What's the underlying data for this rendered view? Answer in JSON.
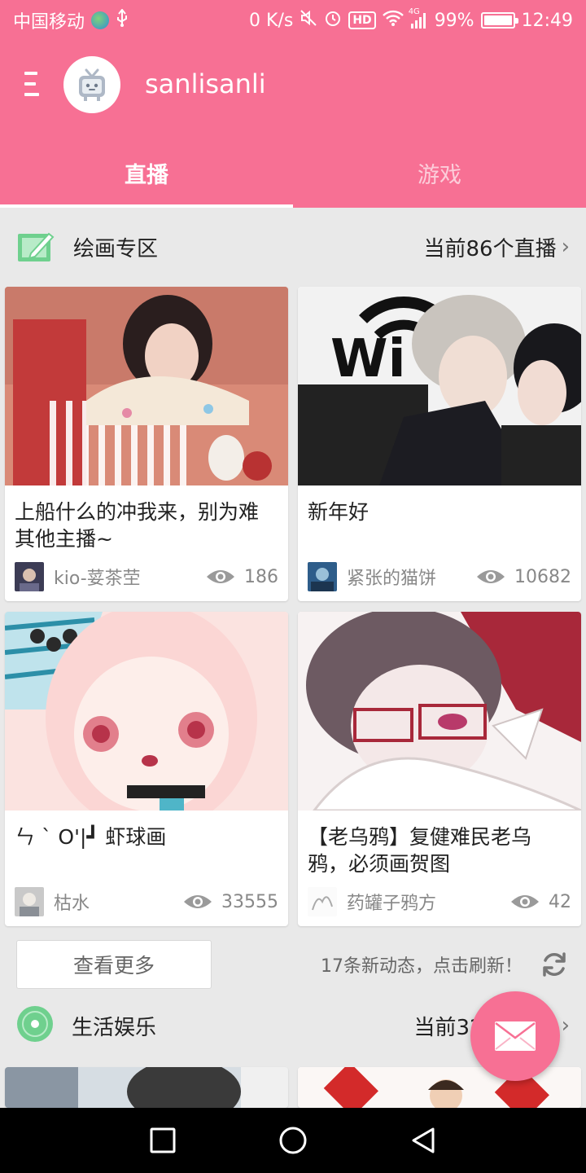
{
  "status_bar": {
    "carrier": "中国移动",
    "net_speed": "0 K/s",
    "signal_label": "4G",
    "hd_label": "HD",
    "battery": "99%",
    "battery_level": 0.99,
    "time": "12:49"
  },
  "header": {
    "username": "sanlisanli",
    "tabs": [
      {
        "label": "直播",
        "active": true
      },
      {
        "label": "游戏",
        "active": false
      }
    ]
  },
  "sections": [
    {
      "title": "绘画专区",
      "right_text": "当前86个直播",
      "icon": "drawing-board-icon",
      "cards": [
        {
          "title": "上船什么的冲我来，别为难其他主播~",
          "owner": "kio-荽茶茔",
          "views": "186"
        },
        {
          "title": "新年好",
          "owner": "紧张的猫饼",
          "views": "10682"
        },
        {
          "title": "ㄣ ` O'|┛ 虾球画",
          "owner": "枯水",
          "views": "33555"
        },
        {
          "title": "【老乌鸦】复健难民老乌鸦，必须画贺图",
          "owner": "药罐子鸦方",
          "views": "42"
        }
      ]
    },
    {
      "title": "生活娱乐",
      "right_text": "当前32",
      "icon": "vinyl-disc-icon"
    }
  ],
  "more_button": "查看更多",
  "refresh_text": "17条新动态，点击刷新！",
  "colors": {
    "accent": "#f77094",
    "section_icon_green": "#6fd08e"
  }
}
